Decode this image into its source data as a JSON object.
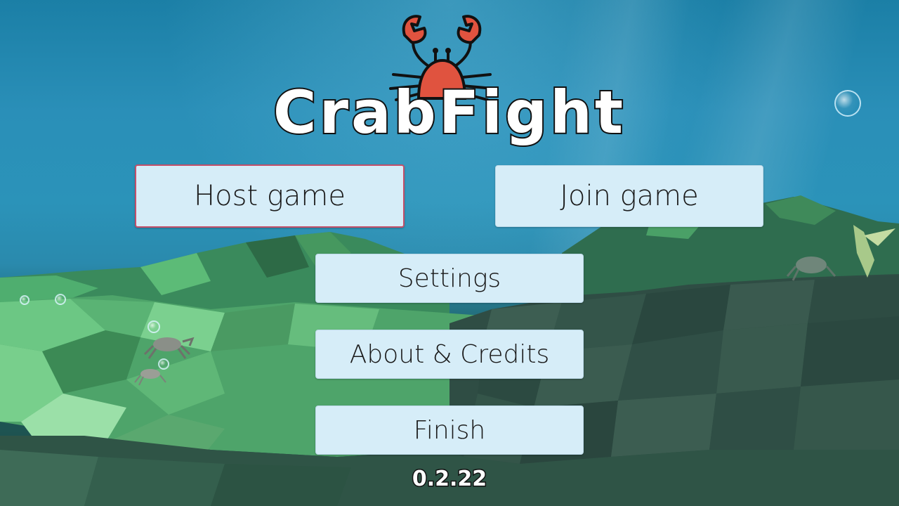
{
  "logo": {
    "title": "CrabFight"
  },
  "menu": {
    "host_label": "Host game",
    "join_label": "Join game",
    "settings_label": "Settings",
    "about_label": "About & Credits",
    "finish_label": "Finish",
    "selected": "Host game"
  },
  "version": "0.2.22",
  "colors": {
    "button_bg": "#d6edf8",
    "selected_border": "#c4506a",
    "crab_body": "#e0533f",
    "water_top": "#1b7fa6",
    "seafloor": "#2f6e4a"
  },
  "icons": [
    "crab-logo-icon",
    "bubble-icon",
    "crab-creature-icon"
  ]
}
